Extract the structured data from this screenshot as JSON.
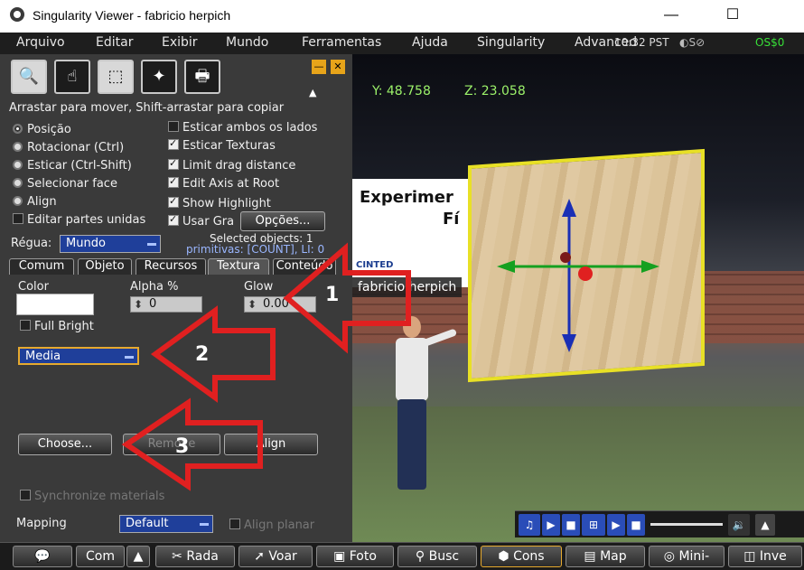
{
  "window": {
    "title": "Singularity Viewer - fabricio herpich",
    "minimize_icon": "—",
    "maximize_icon": "☐"
  },
  "menu": {
    "items": [
      "Arquivo",
      "Editar",
      "Exibir",
      "Mundo",
      "Ferramentas",
      "Ajuda",
      "Singularity",
      "Advanced"
    ],
    "time": "10:32 PST",
    "balance": "OS$0"
  },
  "tools": {
    "buttons": [
      "🔍",
      "☝",
      "⬚",
      "✦",
      "🖶"
    ],
    "hint": "Arrastar para mover, Shift-arrastar para copiar",
    "modes": [
      {
        "label": "Posição",
        "selected": true
      },
      {
        "label": "Rotacionar (Ctrl)",
        "selected": false
      },
      {
        "label": "Esticar (Ctrl-Shift)",
        "selected": false
      },
      {
        "label": "Selecionar face",
        "selected": false
      },
      {
        "label": "Align",
        "selected": false
      }
    ],
    "edit_linked": "Editar partes unidas",
    "options": [
      {
        "label": "Esticar ambos os lados",
        "checked": false
      },
      {
        "label": "Esticar Texturas",
        "checked": true
      },
      {
        "label": "Limit drag distance",
        "checked": true
      },
      {
        "label": "Edit Axis at Root",
        "checked": true
      },
      {
        "label": "Show Highlight",
        "checked": true
      },
      {
        "label": "Usar Gra",
        "checked": true
      }
    ],
    "options_button": "Opções...",
    "ruler_label": "Régua:",
    "ruler_value": "Mundo",
    "selected_objects": "Selected objects: 1",
    "prims": "primitivas: [COUNT], LI: 0",
    "tabs": [
      "Comum",
      "Objeto",
      "Recursos",
      "Textura",
      "Conteúdo"
    ],
    "active_tab": "Textura",
    "color_label": "Color",
    "alpha_label": "Alpha %",
    "alpha_value": "0",
    "glow_label": "Glow",
    "glow_value": "0.00",
    "full_bright": "Full Bright",
    "media_value": "Media",
    "choose_button": "Choose...",
    "remove_button": "Remove",
    "align_button": "Align",
    "sync_materials": "Synchronize materials",
    "mapping_label": "Mapping",
    "mapping_value": "Default",
    "align_planar": "Align planar"
  },
  "world": {
    "y_coord": "Y: 48.758",
    "z_coord": "Z: 23.058",
    "sign_title": "Experimer",
    "sign_sub": "Fí",
    "sign_logo": "CINTED",
    "avatar_name": "fabricio herpich"
  },
  "annotations": [
    "1",
    "2",
    "3"
  ],
  "bottom_bar": [
    "💬",
    "Com",
    "▲",
    "Rada",
    "Voar",
    "Foto",
    "Busc",
    "Cons",
    "Map",
    "Mini-",
    "Inve"
  ],
  "colors": {
    "annotation_arrow": "#e02020",
    "menu_bg": "#1e1e1e",
    "panel_bg": "#3a3a3a",
    "accent_dropdown": "#1f3f9a",
    "balance": "#38e038"
  }
}
